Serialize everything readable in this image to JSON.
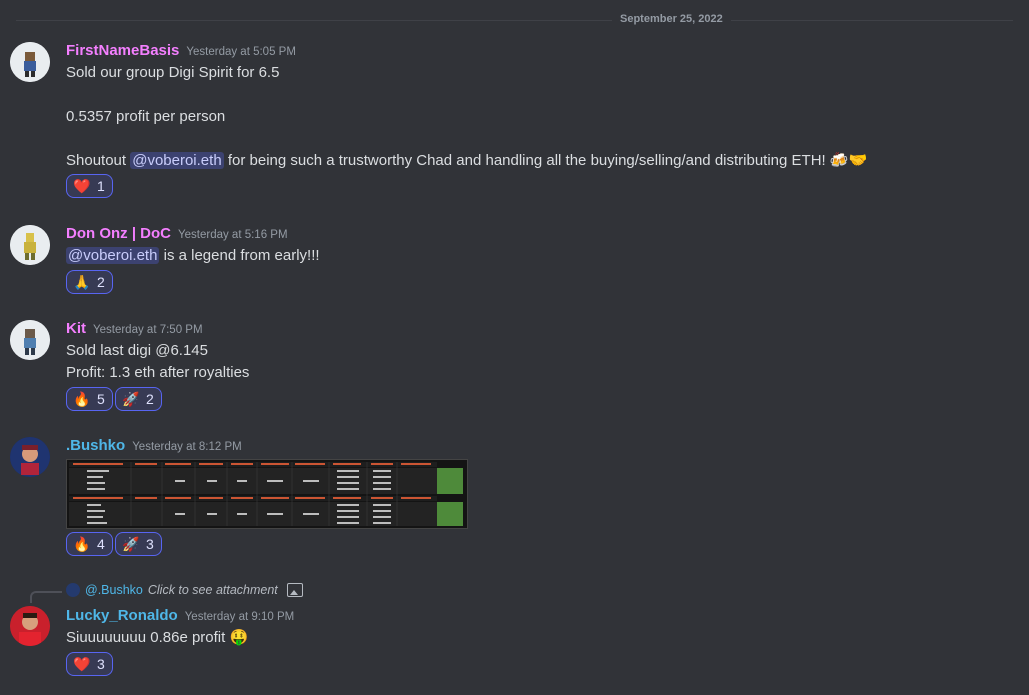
{
  "date_divider": "September 25, 2022",
  "messages": [
    {
      "username": "FirstNameBasis",
      "username_color": "#f47fff",
      "timestamp": "Yesterday at 5:05 PM",
      "lines": [
        "Sold our group Digi Spirit for 6.5",
        "0.5357 profit per person"
      ],
      "shoutout": {
        "prefix": "Shoutout ",
        "mention": "@voberoi.eth",
        "suffix": " for being such a trustworthy Chad and handling all the buying/selling/and distributing ETH!",
        "emoji_1": "🍻",
        "emoji_2": "🤝"
      },
      "reactions": [
        {
          "emoji": "❤️",
          "icon": "heart-icon",
          "count": "1"
        }
      ]
    },
    {
      "username": "Don Onz | DoC",
      "username_color": "#f47fff",
      "timestamp": "Yesterday at 5:16 PM",
      "mention": "@voberoi.eth",
      "text": " is a legend from early!!!",
      "reactions": [
        {
          "emoji": "🙏",
          "icon": "pray-icon",
          "count": "2"
        }
      ]
    },
    {
      "username": "Kit",
      "username_color": "#f47fff",
      "timestamp": "Yesterday at 7:50 PM",
      "lines": [
        "Sold last digi @6.145",
        "Profit: 1.3 eth after royalties"
      ],
      "reactions": [
        {
          "emoji": "🔥",
          "icon": "fire-icon",
          "count": "5"
        },
        {
          "emoji": "🚀",
          "icon": "rocket-icon",
          "count": "2"
        }
      ]
    },
    {
      "username": ".Bushko",
      "username_color": "#4fb7e8",
      "timestamp": "Yesterday at 8:12 PM",
      "reactions": [
        {
          "emoji": "🔥",
          "icon": "fire-icon",
          "count": "4"
        },
        {
          "emoji": "🚀",
          "icon": "rocket-icon",
          "count": "3"
        }
      ]
    },
    {
      "reply": {
        "name": "@.Bushko",
        "text": "Click to see attachment"
      },
      "username": "Lucky_Ronaldo",
      "username_color": "#4fb7e8",
      "timestamp": "Yesterday at 9:10 PM",
      "text": "Siuuuuuuuu 0.86e profit",
      "emoji": "🤑",
      "reactions": [
        {
          "emoji": "❤️",
          "icon": "heart-icon",
          "count": "3"
        }
      ]
    }
  ]
}
